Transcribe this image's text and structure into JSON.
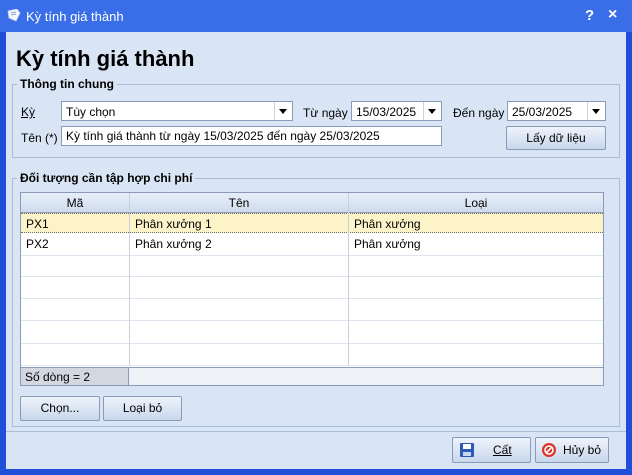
{
  "window": {
    "title": "Kỳ tính giá thành",
    "help_label": "?",
    "close_label": "×"
  },
  "heading": "Kỳ tính giá thành",
  "general": {
    "group_label": "Thông tin chung",
    "period_label": "Kỳ",
    "period_value": "Tùy chọn",
    "from_label": "Từ ngày",
    "from_value": "15/03/2025",
    "to_label": "Đến ngày",
    "to_value": "25/03/2025",
    "name_label": "Tên (*)",
    "name_value": "Kỳ tính giá thành từ ngày 15/03/2025 đến ngày 25/03/2025",
    "fetch_button": "Lấy dữ liệu"
  },
  "cost_objects": {
    "group_label": "Đối tượng cần tập hợp chi phí",
    "columns": [
      "Mã",
      "Tên",
      "Loại"
    ],
    "rows": [
      {
        "code": "PX1",
        "name": "Phân xưởng 1",
        "type": "Phân xưởng"
      },
      {
        "code": "PX2",
        "name": "Phân xưởng 2",
        "type": "Phân xưởng"
      }
    ],
    "row_count": "Số dòng = 2",
    "choose_button": "Chọn...",
    "remove_button": "Loại bỏ"
  },
  "actions": {
    "save_button": "Cất",
    "cancel_button": "Hủy bỏ"
  },
  "colors": {
    "title_bar": "#3a6ee8",
    "frame": "#1f4fd8",
    "client": "#d9e5f5",
    "selected_row": "#fdf3c9"
  }
}
